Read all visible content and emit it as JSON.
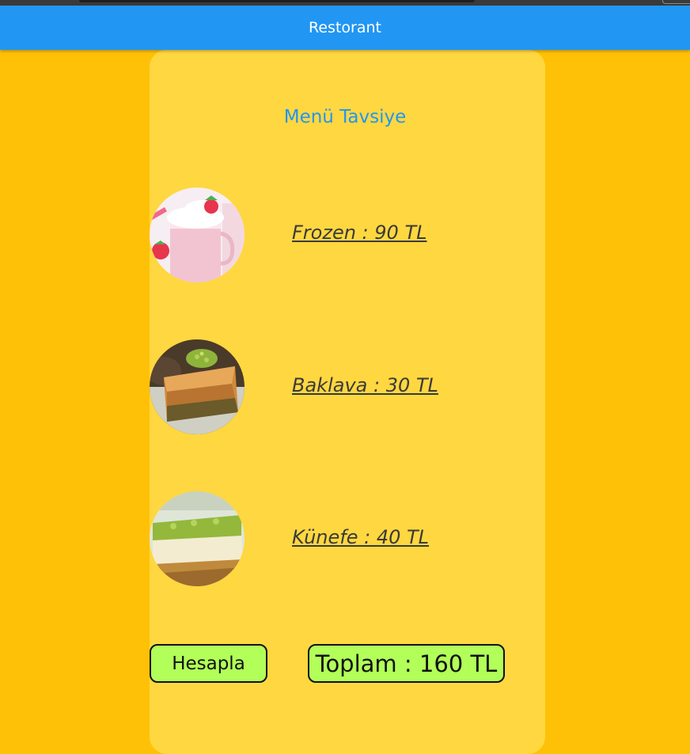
{
  "app_bar": {
    "title": "Restorant"
  },
  "menu": {
    "heading": "Menü Tavsiye",
    "items": [
      {
        "label": "Frozen : 90 TL",
        "icon": "frozen-drink-image"
      },
      {
        "label": "Baklava : 30 TL",
        "icon": "baklava-image"
      },
      {
        "label": "Künefe : 40 TL",
        "icon": "kunefe-image"
      }
    ]
  },
  "actions": {
    "calculate_label": "Hesapla",
    "total_label": "Toplam : 160 TL"
  },
  "colors": {
    "background": "#FFC107",
    "panel": "#FFD740",
    "app_bar": "#2196F3",
    "heading_text": "#2196F3",
    "button": "#B2FF59"
  }
}
